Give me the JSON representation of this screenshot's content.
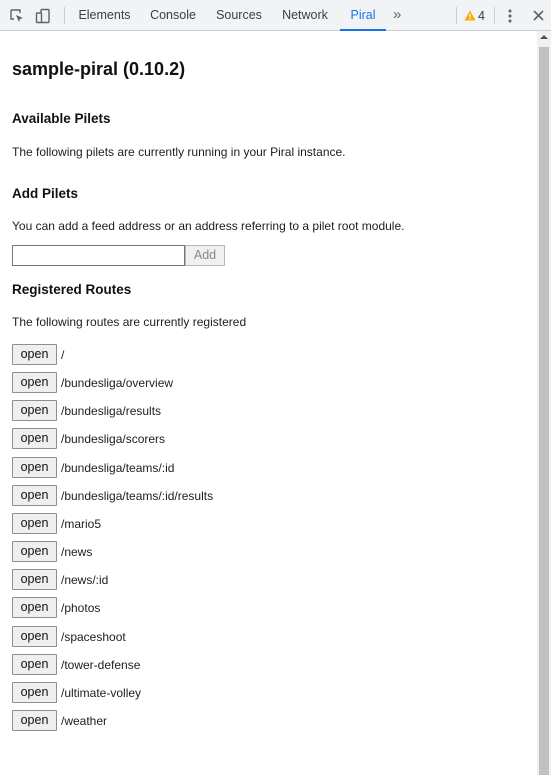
{
  "devtools": {
    "tabs": [
      {
        "label": "Elements"
      },
      {
        "label": "Console"
      },
      {
        "label": "Sources"
      },
      {
        "label": "Network"
      },
      {
        "label": "Piral",
        "active": true
      }
    ],
    "overflow_label": "»",
    "warning_count": "4",
    "accent_color": "#1a73e8",
    "warning_color": "#f9ab00"
  },
  "page": {
    "title": "sample-piral (0.10.2)",
    "available_pilets": {
      "heading": "Available Pilets",
      "text": "The following pilets are currently running in your Piral instance."
    },
    "add_pilets": {
      "heading": "Add Pilets",
      "text": "You can add a feed address or an address referring to a pilet root module.",
      "input_value": "",
      "button_label": "Add"
    },
    "registered_routes": {
      "heading": "Registered Routes",
      "text": "The following routes are currently registered",
      "open_label": "open",
      "routes": [
        "/",
        "/bundesliga/overview",
        "/bundesliga/results",
        "/bundesliga/scorers",
        "/bundesliga/teams/:id",
        "/bundesliga/teams/:id/results",
        "/mario5",
        "/news",
        "/news/:id",
        "/photos",
        "/spaceshoot",
        "/tower-defense",
        "/ultimate-volley",
        "/weather"
      ]
    }
  }
}
